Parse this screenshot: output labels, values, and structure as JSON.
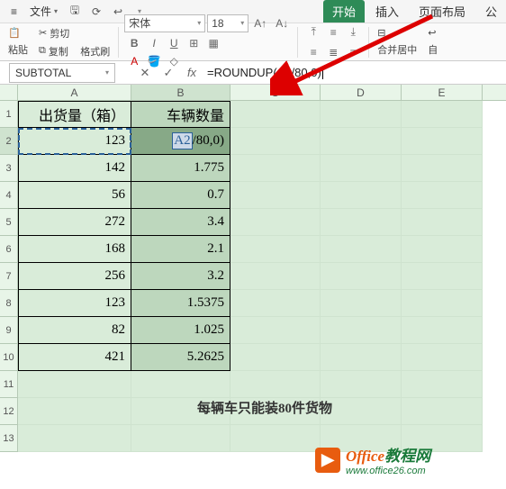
{
  "menubar": {
    "app_icon": "≡",
    "file_label": "文件",
    "tabs": {
      "start": "开始",
      "insert": "插入",
      "layout": "页面布局",
      "more": "公"
    }
  },
  "ribbon": {
    "paste": "粘贴",
    "cut": "剪切",
    "copy": "复制",
    "format_painter": "格式刷",
    "font_name": "宋体",
    "font_size": "18",
    "merge": "合并居中",
    "wrap": "自"
  },
  "formula_bar": {
    "name_box": "SUBTOTAL",
    "formula_prefix": "=ROUNDUP(",
    "formula_ref": "A2",
    "formula_suffix": "/80,0)"
  },
  "columns": [
    "A",
    "B",
    "C",
    "D",
    "E"
  ],
  "headers": {
    "A": "出货量（箱）",
    "B": "车辆数量"
  },
  "editing_cell": {
    "ref": "A2",
    "tail": "/80,0)"
  },
  "rows": [
    {
      "n": 1,
      "a": "出货量（箱）",
      "b": "车辆数量",
      "is_header": true
    },
    {
      "n": 2,
      "a": "123",
      "b_edit": true
    },
    {
      "n": 3,
      "a": "142",
      "b": "1.775"
    },
    {
      "n": 4,
      "a": "56",
      "b": "0.7"
    },
    {
      "n": 5,
      "a": "272",
      "b": "3.4"
    },
    {
      "n": 6,
      "a": "168",
      "b": "2.1"
    },
    {
      "n": 7,
      "a": "256",
      "b": "3.2"
    },
    {
      "n": 8,
      "a": "123",
      "b": "1.5375"
    },
    {
      "n": 9,
      "a": "82",
      "b": "1.025"
    },
    {
      "n": 10,
      "a": "421",
      "b": "5.2625"
    },
    {
      "n": 11,
      "a": "",
      "b": ""
    },
    {
      "n": 12,
      "a": "",
      "b": "",
      "note": true
    },
    {
      "n": 13,
      "a": "",
      "b": ""
    }
  ],
  "note_text": "每辆车只能装80件货物",
  "watermark": {
    "brand1": "Office",
    "brand2": "教程网",
    "url": "www.office26.com"
  }
}
